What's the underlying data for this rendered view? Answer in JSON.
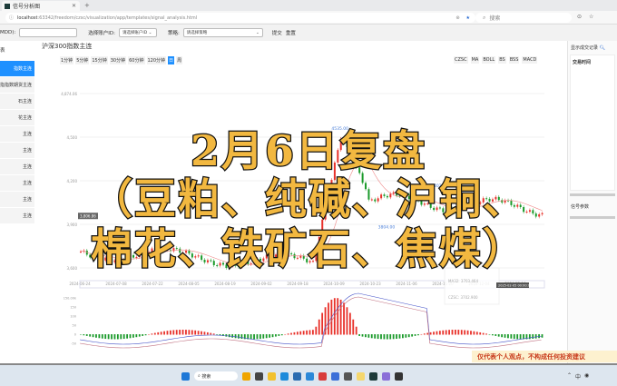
{
  "browser": {
    "tab_title": "信号分析图",
    "url_host": "localhost",
    "url_path": ":63342/freedom/czsc/visualization/app/templates/signal_analysis.html",
    "search_placeholder": "搜索"
  },
  "form": {
    "date_label": "MDD):",
    "date_value": "",
    "account_label": "选择账户ID:",
    "account_value": "请选择账户ID",
    "strategy_label": "策略:",
    "strategy_value": "请选择策略",
    "submit": "提交",
    "reset": "重置"
  },
  "sidebar": {
    "title": "表",
    "items": [
      {
        "label": "指数主连",
        "active": true
      },
      {
        "label": "指指数期货主连"
      },
      {
        "label": "石主连"
      },
      {
        "label": "花主连"
      },
      {
        "label": "主连"
      },
      {
        "label": "主连"
      },
      {
        "label": "主连"
      },
      {
        "label": "主连"
      },
      {
        "label": "主连"
      },
      {
        "label": "主连"
      }
    ]
  },
  "chart": {
    "title": "沪深300指数主连",
    "periods": [
      "1分钟",
      "5分钟",
      "15分钟",
      "30分钟",
      "60分钟",
      "120分钟",
      "日",
      "周"
    ],
    "active_period": "日",
    "indicators": [
      "CZSC",
      "MA",
      "BOLL",
      "BS",
      "BSS",
      "MACD"
    ],
    "y_ticks": [
      "4,874.06",
      "4,500",
      "4,200",
      "3,900",
      "3,600"
    ],
    "x_ticks": [
      "2024-06-24",
      "2024-07-08",
      "2024-07-22",
      "2024-08-05",
      "2024-08-19",
      "2024-09-02",
      "2024-09-18",
      "2024-10-09",
      "2024-10-23",
      "2024-11-06",
      "2024-11-20",
      "2024-12-04",
      "2024-12-18"
    ],
    "annotations": {
      "high": "4535.00",
      "mid_high": "4021.20",
      "low": "3804.00",
      "current": "3,806.86"
    },
    "tooltip": {
      "ma": "MA32: 3703.464",
      "czsc": "CZSC: 3702.900",
      "date": "2025-02-05 00:00:00"
    },
    "macd_ticks": [
      "150.00k",
      "150",
      "100",
      "50",
      "0",
      "-50"
    ]
  },
  "right_panel": {
    "title": "显示成交记录",
    "col": "交易时间",
    "section2": "信号参数"
  },
  "overlay": {
    "line1": "2月6日复盘",
    "line2": "（豆粕、纯碱、沪铜、",
    "line3": "棉花、铁矿石、焦煤）"
  },
  "watermark": "仅代表个人观点，不构成任何投资建议",
  "taskbar": {
    "search": "搜索",
    "ime": "中"
  },
  "colors": {
    "accent": "#1e90ff",
    "up": "#e8312a",
    "down": "#1a9a2a",
    "overlay_text": "#f2b840"
  }
}
